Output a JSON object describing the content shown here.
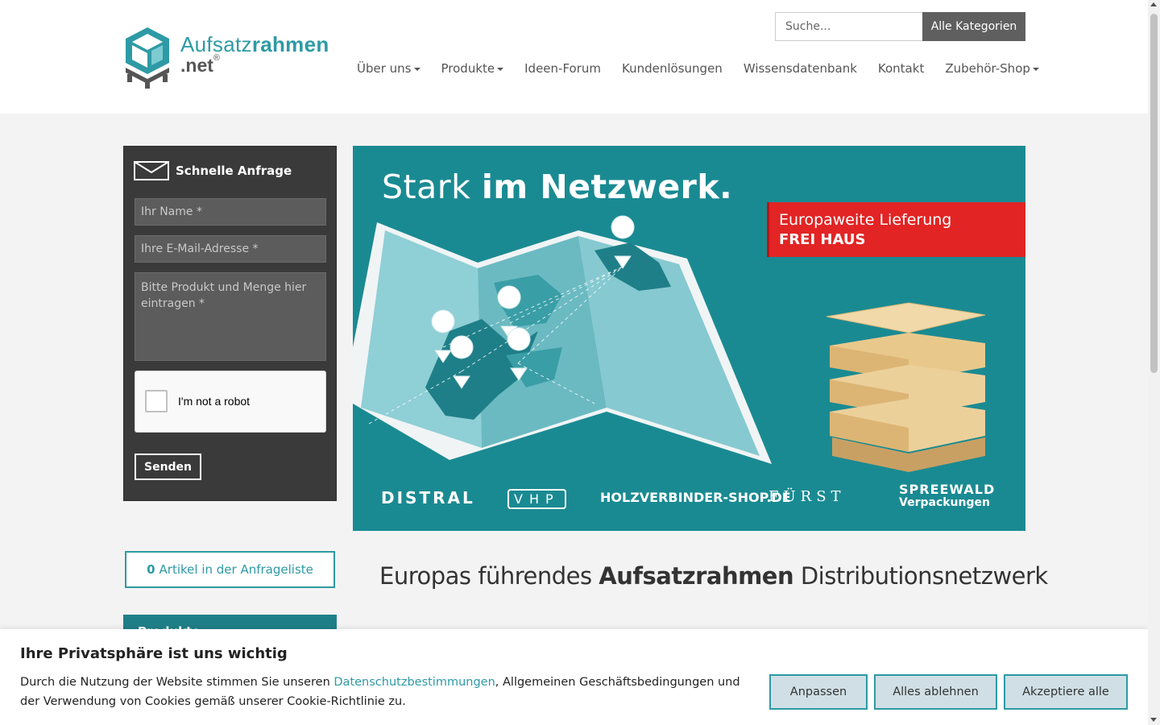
{
  "header": {
    "logo": {
      "part1": "Aufsatz",
      "part2": "rahmen",
      "part3": ".net",
      "reg": "®"
    },
    "search": {
      "placeholder": "Suche...",
      "category_button": "Alle Kategorien"
    },
    "nav": [
      {
        "label": "Über uns",
        "dropdown": true
      },
      {
        "label": "Produkte",
        "dropdown": true
      },
      {
        "label": "Ideen-Forum",
        "dropdown": false
      },
      {
        "label": "Kundenlösungen",
        "dropdown": false
      },
      {
        "label": "Wissensdatenbank",
        "dropdown": false
      },
      {
        "label": "Kontakt",
        "dropdown": false
      },
      {
        "label": "Zubehör-Shop",
        "dropdown": true
      }
    ]
  },
  "quick_form": {
    "title": "Schnelle Anfrage",
    "name_placeholder": "Ihr Name *",
    "email_placeholder": "Ihre E-Mail-Adresse *",
    "message_placeholder": "Bitte Produkt und Menge hier eintragen *",
    "recaptcha_label": "I'm not a robot",
    "submit_label": "Senden"
  },
  "inquiry_list": {
    "count": "0",
    "label": "Artikel in der Anfrageliste"
  },
  "products_box": {
    "label": "Produkte"
  },
  "banner": {
    "title_light": "Stark ",
    "title_bold": "im Netzwerk.",
    "delivery_line1": "Europaweite Lieferung",
    "delivery_line2": "FREI HAUS",
    "partners": [
      "DISTRAL",
      "VHP",
      "HOLZVERBINDER-SHOP.DE",
      "FÜRST",
      "SPREEWALD",
      "Verpackungen"
    ]
  },
  "headline": {
    "pre": "Europas führendes ",
    "bold": "Aufsatzrahmen",
    "post": " Distributionsnetzwerk"
  },
  "cookie": {
    "title": "Ihre Privatsphäre ist uns wichtig",
    "text_pre": "Durch die Nutzung der Website stimmen Sie unseren ",
    "link": "Datenschutzbestimmungen",
    "text_post": ", Allgemeinen Geschäftsbedingungen und der Verwendung von Cookies gemäß unserer Cookie-Richtlinie zu.",
    "btn_customize": "Anpassen",
    "btn_reject": "Alles ablehnen",
    "btn_accept": "Akzeptiere alle"
  },
  "colors": {
    "brand": "#2e9aa5",
    "banner_bg": "#1a8a92",
    "red": "#e22424",
    "form_bg": "#3a3a3a"
  }
}
